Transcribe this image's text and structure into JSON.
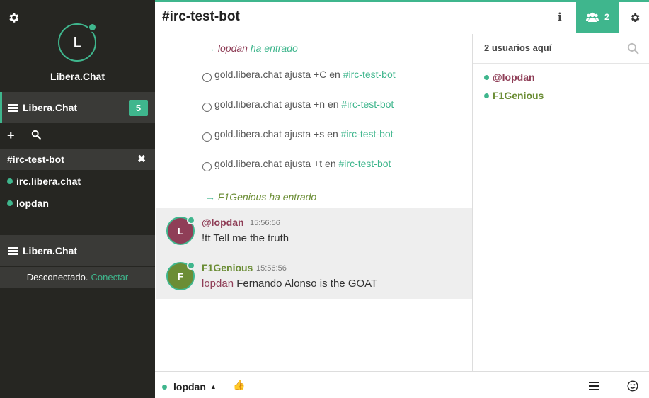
{
  "sidebar": {
    "avatar_letter": "L",
    "network_name": "Libera.Chat",
    "network": {
      "label": "Libera.Chat",
      "badge": "5"
    },
    "tools": {
      "add": "+",
      "search_icon": "search-icon"
    },
    "channels": [
      {
        "label": "#irc-test-bot",
        "selected": true,
        "close": "✖"
      },
      {
        "label": "irc.libera.chat",
        "selected": false
      },
      {
        "label": "lopdan",
        "selected": false
      }
    ],
    "network2": {
      "label": "Libera.Chat",
      "status": "Desconectado.",
      "connect_link": "Conectar"
    }
  },
  "header": {
    "title": "#irc-test-bot",
    "info": "i",
    "users_count": "2"
  },
  "messages": {
    "join1": {
      "nick": "lopdan",
      "text": "ha entrado",
      "arrow": "→"
    },
    "modes": [
      {
        "info": "i",
        "text": "gold.libera.chat ajusta +C en",
        "chan": "#irc-test-bot"
      },
      {
        "info": "i",
        "text": "gold.libera.chat ajusta +n en",
        "chan": "#irc-test-bot"
      },
      {
        "info": "i",
        "text": "gold.libera.chat ajusta +s en",
        "chan": "#irc-test-bot"
      },
      {
        "info": "i",
        "text": "gold.libera.chat ajusta +t en",
        "chan": "#irc-test-bot"
      }
    ],
    "join2": {
      "nick": "F1Genious",
      "text": "ha entrado",
      "arrow": "→"
    },
    "chat": [
      {
        "avatar": "L",
        "nick": "@lopdan",
        "time": "15:56:56",
        "text": "!tt Tell me the truth",
        "mention": ""
      },
      {
        "avatar": "F",
        "nick": "F1Genious",
        "time": "15:56:56",
        "text": "Fernando Alonso is the GOAT",
        "mention": "lopdan"
      }
    ]
  },
  "members": {
    "count_label": "2 usuarios aquí",
    "list": [
      {
        "nick": "@lopdan"
      },
      {
        "nick": "F1Genious"
      }
    ]
  },
  "input": {
    "nick": "lopdan",
    "caret": "▲",
    "thumb": "👍"
  },
  "colors": {
    "accent": "#3fb68d",
    "sidebar_bg": "#262622",
    "lopdan": "#8f3e57",
    "f1genious": "#6b8d35"
  }
}
